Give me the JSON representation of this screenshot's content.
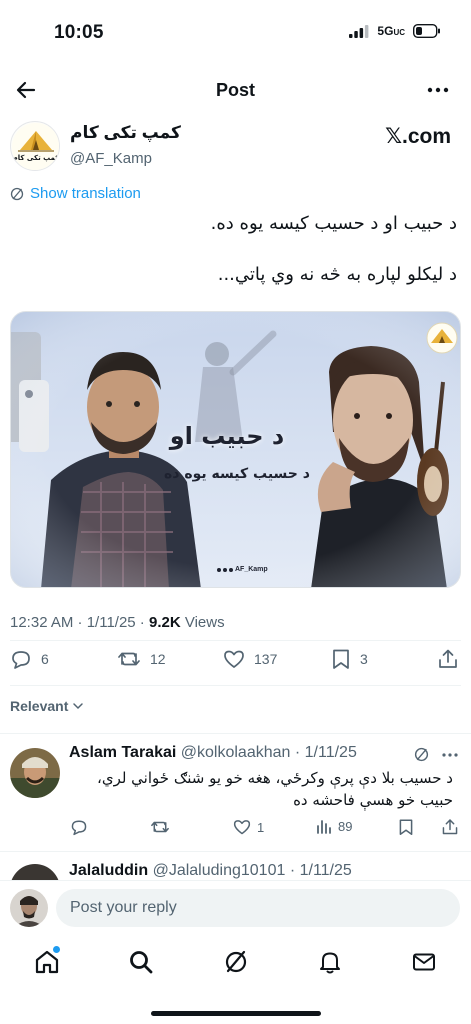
{
  "status_bar": {
    "time": "10:05",
    "network": "5G",
    "network_suffix": "UC"
  },
  "header": {
    "title": "Post"
  },
  "author": {
    "name": "کمپ تکی کام",
    "handle": "@AF_Kamp",
    "logo_text": "کمپ تکی کام",
    "site_link": "𝕏.com"
  },
  "post": {
    "show_translation": "Show translation",
    "text_line1": "د حبیب او د حسیب کیسه یوه ده.",
    "text_line2": "د لیکلو لپاره به څه نه وي پاتي...",
    "timestamp": "12:32 AM · 1/11/25 · ",
    "views_count": "9.2K",
    "views_label": " Views"
  },
  "media": {
    "headline": "د حبیب او",
    "subline": "د حسیب کیسه یوه ده",
    "watermark": "AF_Kamp",
    "badge_text": "کمپ تکی کام"
  },
  "actions": {
    "replies": "6",
    "reposts": "12",
    "likes": "137",
    "bookmarks": "3"
  },
  "sort": {
    "label": "Relevant"
  },
  "replies": [
    {
      "name": "Aslam Tarakai",
      "handle": "@kolkolaakhan",
      "date": "1/11/25",
      "separator": " · ",
      "text": "د حسيب بلا دې پرې وکرځي، هغه خو یو شنګ ځواني لري، حبیب خو هسې فاحشه ده",
      "likes": "1",
      "views": "89"
    },
    {
      "name": "Jalaluddin",
      "handle": "@Jalaluding10101",
      "date": "1/11/25",
      "separator": " · "
    }
  ],
  "composer": {
    "placeholder": "Post your reply"
  },
  "colors": {
    "accent": "#1d9bf0",
    "text": "#0f1419",
    "muted": "#536471"
  }
}
